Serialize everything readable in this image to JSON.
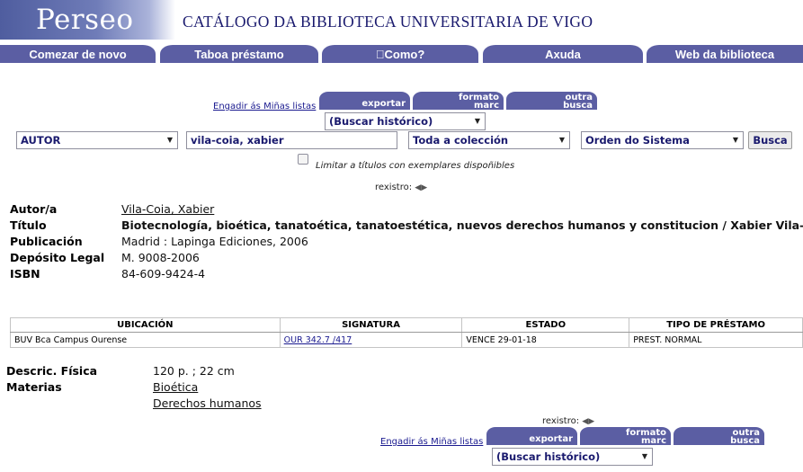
{
  "header": {
    "logo": "Perseo",
    "title": "CATÁLOGO DA BIBLIOTECA UNIVERSITARIA DE VIGO"
  },
  "nav": [
    {
      "label": "Comezar de novo"
    },
    {
      "label": "Taboa préstamo"
    },
    {
      "label": "\u0000Como?"
    },
    {
      "label": "Axuda"
    },
    {
      "label": "Web da biblioteca"
    }
  ],
  "toolbar_top": {
    "lists_link": "Engadir ás Miñas listas",
    "export": "exportar",
    "marc": "formato\nmarc",
    "other": "outra\nbusca",
    "history": "(Buscar histórico)"
  },
  "search": {
    "index": "AUTOR",
    "query": "vila-coia, xabier",
    "collection": "Toda a colección",
    "sort": "Orden do Sistema",
    "button": "Busca",
    "limit_label": "Limitar a títulos con exemplares dispoñibles"
  },
  "record_nav": {
    "label": "rexistro:"
  },
  "record": {
    "fields": [
      {
        "label": "Autor/a",
        "value": "Vila-Coia, Xabier",
        "link": true
      },
      {
        "label": "Título",
        "value": "Biotecnología, bioética, tanatoética, tanatoestética, nuevos derechos humanos y constitucion / Xabier Vila-Coia",
        "bold": true
      },
      {
        "label": "Publicación",
        "value": "Madrid : Lapinga Ediciones, 2006"
      },
      {
        "label": "Depósito Legal",
        "value": "M. 9008-2006"
      },
      {
        "label": "ISBN",
        "value": "84-609-9424-4"
      }
    ]
  },
  "holdings": {
    "headers": [
      "UBICACIÓN",
      "SIGNATURA",
      "ESTADO",
      "TIPO DE PRÉSTAMO"
    ],
    "rows": [
      [
        "BUV Bca Campus Ourense",
        "OUR 342.7 /417",
        "VENCE 29-01-18",
        "PREST. NORMAL"
      ]
    ]
  },
  "details": {
    "physical_label": "Descric. Física",
    "physical_value": "120 p. ; 22 cm",
    "subjects_label": "Materias",
    "subjects": [
      "Bioética",
      "Derechos humanos"
    ]
  },
  "record_nav_bottom": {
    "label": "rexistro:"
  },
  "toolbar_bottom": {
    "lists_link": "Engadir ás Miñas listas",
    "export": "exportar",
    "marc": "formato\nmarc",
    "other": "outra\nbusca",
    "history": "(Buscar histórico)"
  }
}
